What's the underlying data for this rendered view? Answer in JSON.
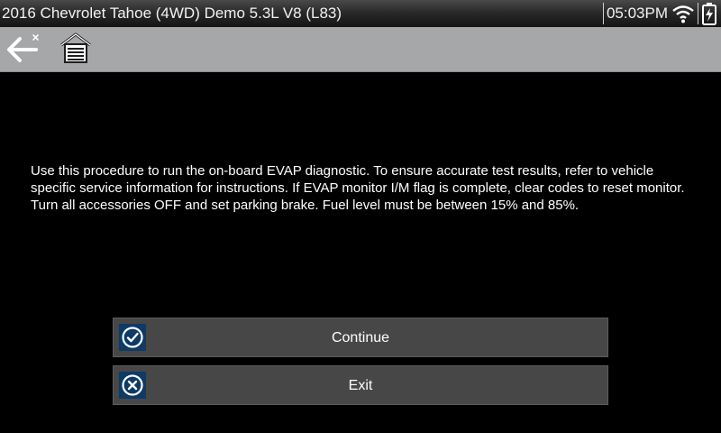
{
  "titlebar": {
    "vehicle_title": "2016 Chevrolet Tahoe (4WD) Demo 5.3L V8 (L83)",
    "time": "05:03PM",
    "wifi_icon": "wifi-icon",
    "battery_icon": "battery-charging-icon"
  },
  "toolbar": {
    "back_icon": "back-arrow-icon",
    "home_icon": "home-icon"
  },
  "main": {
    "instructions": "Use this procedure to run the on-board EVAP diagnostic. To ensure accurate test results, refer to vehicle specific service information for instructions. If EVAP monitor I/M flag is complete, clear codes to reset monitor. Turn all accessories OFF and set parking brake. Fuel level must be between 15% and 85%."
  },
  "buttons": {
    "continue_label": "Continue",
    "continue_icon": "check-circle-icon",
    "exit_label": "Exit",
    "exit_icon": "x-circle-icon"
  },
  "colors": {
    "background": "#000000",
    "toolbar": "#a6a7a9",
    "button": "#474747",
    "icon_tile": "#0e3a66"
  }
}
